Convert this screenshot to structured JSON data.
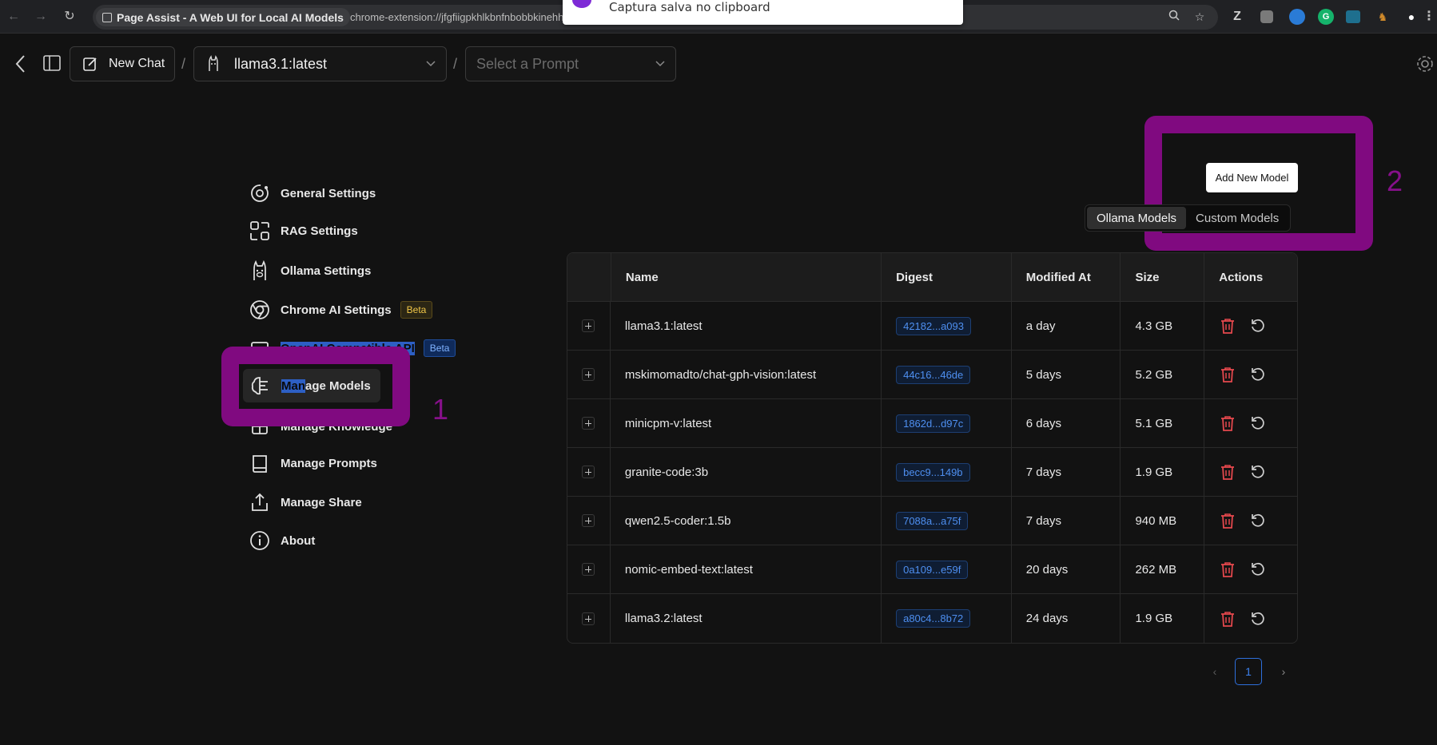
{
  "browser": {
    "tab_title": "Page Assist - A Web UI for Local AI Models",
    "url": "chrome-extension://jfgfiigpkhlkbnfnbobbkinehhfdhndo/options.html#/settings/model",
    "back_symbol": "←",
    "forward_symbol": "→",
    "reload_symbol": "↻"
  },
  "toast": {
    "text": "Captura salva no clipboard"
  },
  "header": {
    "new_chat_label": "New Chat",
    "separator": "/",
    "model_selected": "llama3.1:latest",
    "prompt_placeholder": "Select a Prompt"
  },
  "sidebar": {
    "items": [
      {
        "label": "General Settings",
        "icon": "general-settings-icon"
      },
      {
        "label": "RAG Settings",
        "icon": "rag-settings-icon"
      },
      {
        "label": "Ollama Settings",
        "icon": "llama-icon"
      },
      {
        "label": "Chrome AI Settings",
        "icon": "chrome-icon",
        "badge": "Beta"
      },
      {
        "label": "OpenAI Compatible API",
        "icon": "api-icon",
        "badge": "Beta"
      },
      {
        "label": "Manage Models",
        "label_selected_part": "Man",
        "label_rest": "age Models",
        "icon": "brain-icon"
      },
      {
        "label": "Manage Knowledge",
        "icon": "knowledge-icon"
      },
      {
        "label": "Manage Prompts",
        "icon": "book-icon"
      },
      {
        "label": "Manage Share",
        "icon": "share-icon"
      },
      {
        "label": "About",
        "icon": "info-icon"
      }
    ]
  },
  "annotations": {
    "one": "1",
    "two": "2",
    "color": "#800a80"
  },
  "models_page": {
    "add_button": "Add New Model",
    "tabs": [
      "Ollama Models",
      "Custom Models"
    ],
    "active_tab": "Ollama Models",
    "columns": [
      "Name",
      "Digest",
      "Modified At",
      "Size",
      "Actions"
    ],
    "rows": [
      {
        "name": "llama3.1:latest",
        "digest": "42182...a093",
        "modified": "a day",
        "size": "4.3 GB"
      },
      {
        "name": "mskimomadto/chat-gph-vision:latest",
        "digest": "44c16...46de",
        "modified": "5 days",
        "size": "5.2 GB"
      },
      {
        "name": "minicpm-v:latest",
        "digest": "1862d...d97c",
        "modified": "6 days",
        "size": "5.1 GB"
      },
      {
        "name": "granite-code:3b",
        "digest": "becc9...149b",
        "modified": "7 days",
        "size": "1.9 GB"
      },
      {
        "name": "qwen2.5-coder:1.5b",
        "digest": "7088a...a75f",
        "modified": "7 days",
        "size": "940 MB"
      },
      {
        "name": "nomic-embed-text:latest",
        "digest": "0a109...e59f",
        "modified": "20 days",
        "size": "262 MB"
      },
      {
        "name": "llama3.2:latest",
        "digest": "a80c4...8b72",
        "modified": "24 days",
        "size": "1.9 GB"
      }
    ],
    "pagination": {
      "current": "1",
      "prev": "‹",
      "next": "›"
    }
  },
  "colors": {
    "accent_blue": "#3d82f0",
    "delete_red": "#e5484d",
    "beta_yellow": "#f0c648"
  }
}
